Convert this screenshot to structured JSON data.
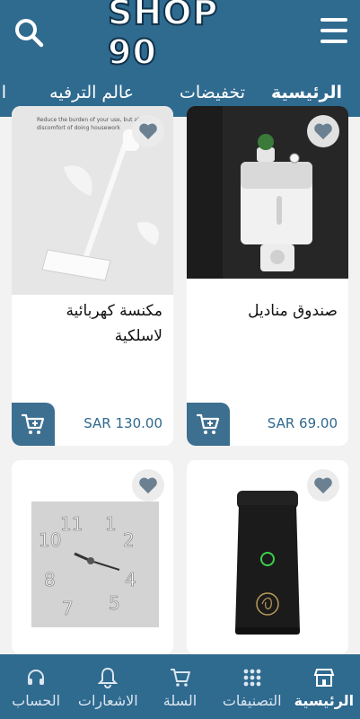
{
  "header": {
    "logo_text": "SHOP 90",
    "search_icon": "search-icon",
    "menu_icon": "hamburger-menu-icon"
  },
  "tabs": [
    {
      "label": "الرئيسية",
      "active": true
    },
    {
      "label": "تخفيضات",
      "active": false
    },
    {
      "label": "عالم الترفيه",
      "active": false
    },
    {
      "label": "ال",
      "active": false
    }
  ],
  "products": [
    {
      "name": "صندوق مناديل",
      "price": "SAR 69.00",
      "image": "tissue-box-image"
    },
    {
      "name": "مكنسة كهربائية لاسلكية",
      "price": "SAR 130.00",
      "image": "cordless-vacuum-image",
      "image_caption": "Reduce the burden of your use, but also m... discomfort of doing housework"
    },
    {
      "name": "",
      "price": "",
      "image": "incense-burner-image"
    },
    {
      "name": "",
      "price": "",
      "image": "wall-clock-image"
    }
  ],
  "bottom_nav": [
    {
      "label": "الرئيسية",
      "icon": "store-icon",
      "active": true
    },
    {
      "label": "التصنيفات",
      "icon": "grid-icon",
      "active": false
    },
    {
      "label": "السلة",
      "icon": "cart-icon",
      "active": false
    },
    {
      "label": "الاشعارات",
      "icon": "bell-icon",
      "active": false
    },
    {
      "label": "الحساب",
      "icon": "headset-icon",
      "active": false
    }
  ],
  "colors": {
    "primary": "#2f6a8f",
    "cart_button": "#3d6f90",
    "price_text": "#2f6a8f"
  }
}
